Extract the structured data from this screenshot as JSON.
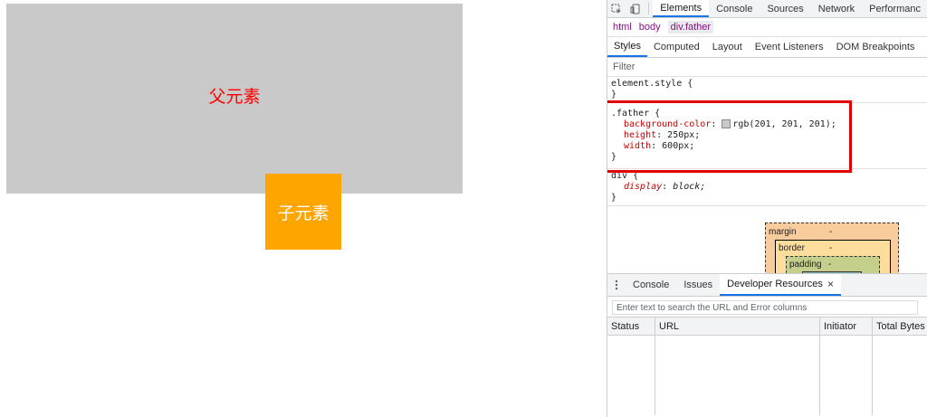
{
  "page": {
    "father_label": "父元素",
    "child_label": "子元素",
    "colors": {
      "father_bg": "#c9c9c9",
      "father_text": "#ff0000",
      "child_bg": "#ffa500",
      "child_text": "#ffffff"
    }
  },
  "devtools": {
    "toolbar": {
      "inspect_icon": "inspect-element-icon",
      "device_icon": "device-toolbar-icon",
      "tabs": [
        "Elements",
        "Console",
        "Sources",
        "Network",
        "Performanc"
      ]
    },
    "breadcrumbs": [
      "html",
      "body",
      "div.father"
    ],
    "subtabs": [
      "Styles",
      "Computed",
      "Layout",
      "Event Listeners",
      "DOM Breakpoints",
      "P"
    ],
    "filter_placeholder": "Filter",
    "rules": {
      "element_style": {
        "selector": "element.style {",
        "close": "}"
      },
      "father": {
        "selector": ".father {",
        "bg_name": "background-color",
        "bg_value": "rgb(201, 201, 201);",
        "height_name": "height",
        "height_value": "250px;",
        "width_name": "width",
        "width_value": "600px;",
        "close": "}"
      },
      "div": {
        "selector": "div {",
        "display_name": "display",
        "display_value": "block;",
        "close": "}"
      }
    },
    "box_model": {
      "margin_label": "margin",
      "margin_value": "-",
      "border_label": "border",
      "border_value": "-",
      "padding_label": "padding",
      "padding_value": "-"
    },
    "drawer": {
      "menu_icon": "more-vertical-icon",
      "tabs": [
        "Console",
        "Issues",
        "Developer Resources"
      ],
      "close_glyph": "×",
      "search_placeholder": "Enter text to search the URL and Error columns",
      "columns": [
        "Status",
        "URL",
        "Initiator",
        "Total Bytes"
      ]
    }
  }
}
